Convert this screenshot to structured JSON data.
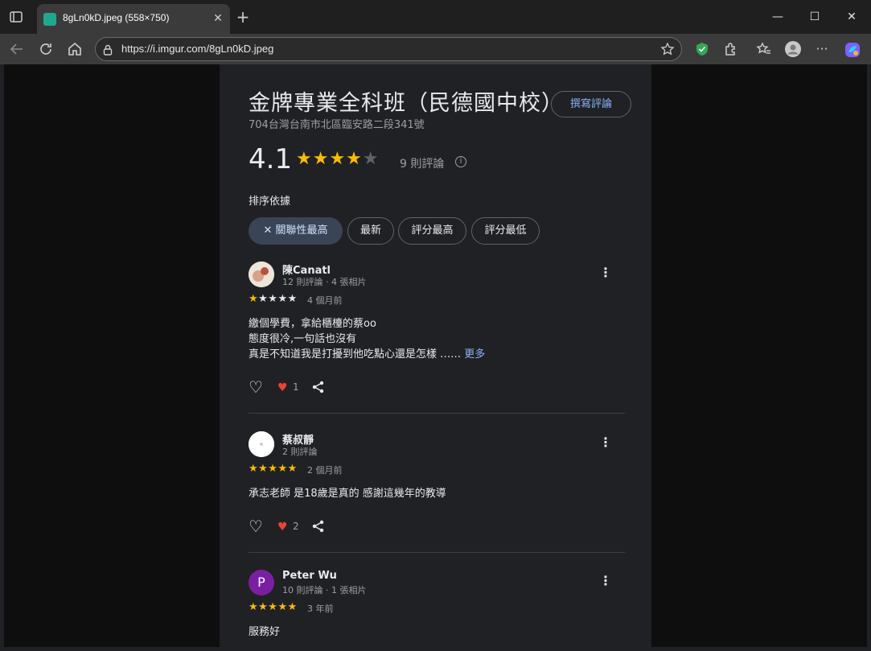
{
  "browser": {
    "tab_title": "8gLn0kD.jpeg (558×750)",
    "url": "https://i.imgur.com/8gLn0kD.jpeg"
  },
  "place": {
    "name": "金牌專業全科班（民德國中校）",
    "address": "704台灣台南市北區臨安路二段341號",
    "write_review": "撰寫評論",
    "rating": "4.1",
    "rating_value": 4.1,
    "review_count": "9 則評論",
    "sort_label": "排序依據",
    "sort_chips": [
      {
        "label": "關聯性最高",
        "active": true
      },
      {
        "label": "最新",
        "active": false
      },
      {
        "label": "評分最高",
        "active": false
      },
      {
        "label": "評分最低",
        "active": false
      }
    ]
  },
  "reviews": [
    {
      "name": "陳Canatl",
      "meta": "12 則評論 · 4 張相片",
      "stars": 1,
      "time": "4 個月前",
      "lines": [
        "繳個學費，拿給櫃檯的蔡oo",
        "態度很冷,一句話也沒有",
        "真是不知道我是打擾到他吃點心還是怎樣 ……"
      ],
      "more": "更多",
      "reactions": "1",
      "avatar_color": "#e7d3c8"
    },
    {
      "name": "蔡叔靜",
      "meta": "2 則評論",
      "stars": 5,
      "time": "2 個月前",
      "lines": [
        "承志老師 是18歲是真的 感謝這幾年的教導"
      ],
      "more": "",
      "reactions": "2",
      "avatar_color": "#ffffff"
    },
    {
      "name": "Peter Wu",
      "meta": "10 則評論 · 1 張相片",
      "stars": 5,
      "time": "3 年前",
      "lines": [
        "服務好"
      ],
      "more": "",
      "reactions": "",
      "avatar_letter": "P",
      "avatar_color": "#7b1fa2"
    }
  ],
  "colors": {
    "accent_blue": "#8ab4f8",
    "star_gold": "#fbbc04",
    "panel_bg": "#202124"
  }
}
